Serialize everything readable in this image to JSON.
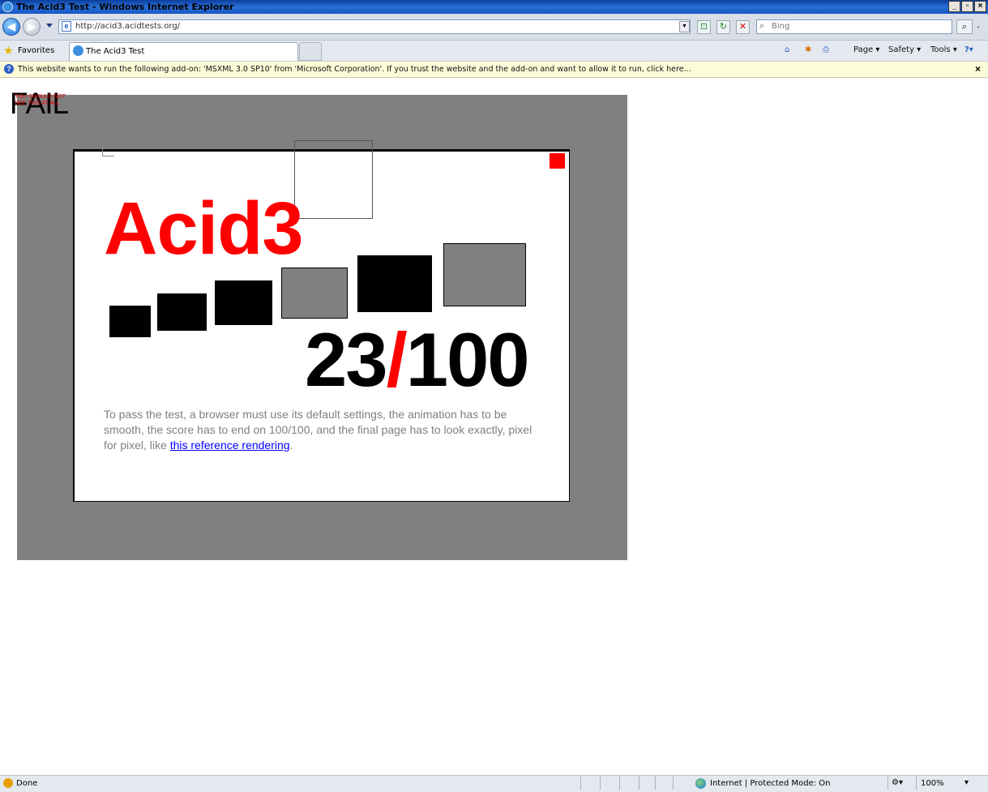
{
  "window": {
    "title": "The Acid3 Test - Windows Internet Explorer",
    "minimize": "_",
    "restore": "▫",
    "close": "×"
  },
  "nav": {
    "back_icon": "arrow-left-icon",
    "back_glyph": "◀",
    "forward_icon": "arrow-right-icon",
    "forward_glyph": "▶",
    "address": "http://acid3.acidtests.org/",
    "address_dd": "▼",
    "compat_glyph": "⊡",
    "refresh_glyph": "↻",
    "stop_glyph": "✕",
    "search_placeholder": "Bing",
    "search_glyph": "⌕",
    "search_go_glyph": "⌕",
    "search_dd_glyph": "-"
  },
  "tabs": {
    "favorites_label": "Favorites",
    "favorites_glyph": "★",
    "active_tab_label": "The Acid3 Test"
  },
  "commands": {
    "feeds_glyph": "⌂",
    "page": "Page ▾",
    "safety": "Safety ▾",
    "tools": "Tools ▾",
    "help": "?▾"
  },
  "infobar": {
    "glyph": "?",
    "text": "This website wants to run the following add-on: 'MSXML 3.0 SP10' from 'Microsoft Corporation'. If you trust the website and the add-on and want to allow it to run, click here...",
    "close": "×"
  },
  "page": {
    "fail": "FAIL",
    "overlay_text": "YOU SHOULD NOT SEE THIS AT ALL",
    "title": "Acid3",
    "score_num": "23",
    "score_slash": "/",
    "score_den": "100",
    "description": "To pass the test, a browser must use its default settings, the animation has to be smooth, the score has to end on 100/100, and the final page has to look exactly, pixel for pixel, like ",
    "link": "this reference rendering",
    "description_end": "."
  },
  "status": {
    "text": "Done",
    "zone": "Internet | Protected Mode: On",
    "zoom": "100%"
  },
  "colors": {
    "accent_red": "#ff0000",
    "gray": "#808080"
  }
}
